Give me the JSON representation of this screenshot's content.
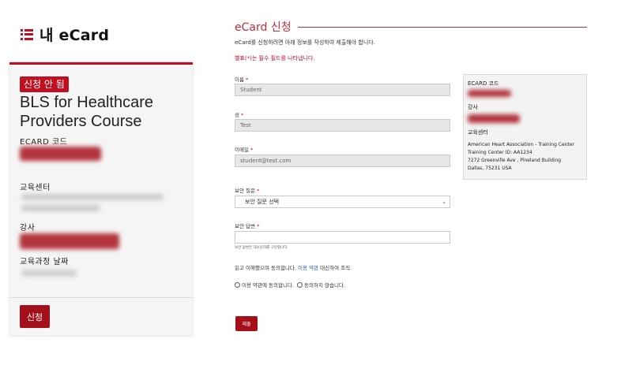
{
  "header": {
    "title": "내 eCard",
    "icon": "list-icon"
  },
  "card": {
    "status_badge": "신청 안 됨",
    "course_title": "BLS for Healthcare Providers Course",
    "ecard_code_label": "ECARD 코드",
    "training_center_label": "교육센터",
    "instructor_label": "강사",
    "course_date_label": "교육과정 날짜",
    "apply_button": "신청"
  },
  "form": {
    "title": "eCard 신청",
    "intro": "eCard를 신청하려면 아래 정보를 작성하여 제출해야 합니다.",
    "required_note": "별표(*)는 필수 필드를 나타냅니다.",
    "first_name": {
      "label": "이름",
      "value": "Student"
    },
    "last_name": {
      "label": "성",
      "value": "Test"
    },
    "email": {
      "label": "이메일",
      "value": "student@test.com"
    },
    "security_question": {
      "label": "보안 질문",
      "value": "보안 질문 선택"
    },
    "security_answer": {
      "label": "보안 답변",
      "value": "",
      "hint": "보안 답변은 대소문자를 구분합니다."
    },
    "agreement": {
      "text_before": "읽고 이해했으며 동의합니다.",
      "terms_link": "이용 약관",
      "text_after": "대신하여 조직.",
      "agree_option": "이용 약관에 동의합니다.",
      "disagree_option": "동의하지 않습니다."
    },
    "submit_button": "제출"
  },
  "info_panel": {
    "ecard_code_label": "ECARD 코드",
    "instructor_label": "강사",
    "training_center_label": "교육센터",
    "center_name": "American Heart Association - Training Center",
    "center_id": "Training Center ID: AA1234",
    "center_address": "7272 Greenville Ave , Pineland Building",
    "center_city": "Dallas,    75231 USA"
  },
  "colors": {
    "brand_red": "#c00f20",
    "button_red": "#a40f1a",
    "field_gray": "#e7e7e7"
  }
}
